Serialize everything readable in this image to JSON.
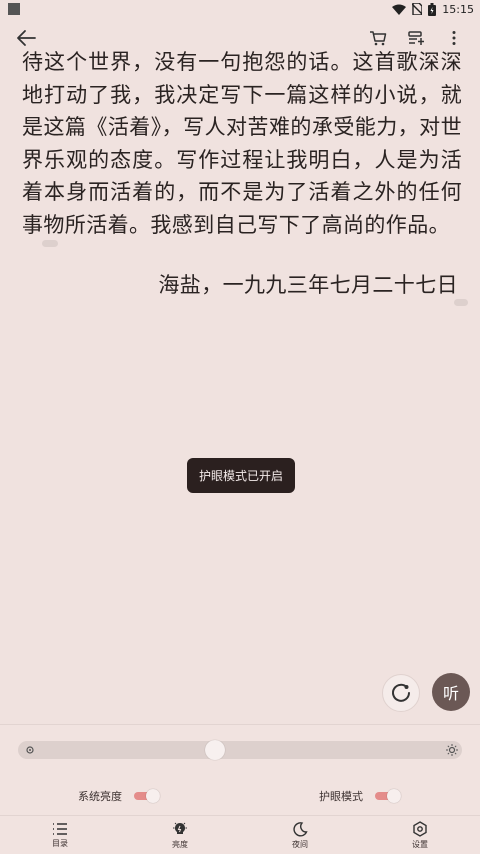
{
  "status_bar": {
    "time": "15:15"
  },
  "toolbar": {
    "back_icon": "arrow-left-icon",
    "cart_icon": "cart-icon",
    "bookshelf_icon": "bookshelf-add-icon",
    "more_icon": "more-vertical-icon"
  },
  "reading": {
    "paragraph": "待这个世界，没有一句抱怨的话。这首歌深深地打动了我，我决定写下一篇这样的小说，就是这篇《活着》，写人对苦难的承受能力，对世界乐观的态度。写作过程让我明白，人是为活着本身而活着的，而不是为了活着之外的任何事物所活着。我感到自己写下了高尚的作品。",
    "date_line": "海盐，一九九三年七月二十七日"
  },
  "toast": {
    "text": "护眼模式已开启"
  },
  "fab": {
    "listen_label": "听"
  },
  "panel": {
    "brightness_level": 0.44,
    "system_brightness_label": "系统亮度",
    "eye_protection_label": "护眼模式",
    "accent_color": "#e48c8a"
  },
  "bottom_nav": [
    {
      "label": "目录",
      "icon": "list-icon"
    },
    {
      "label": "亮度",
      "icon": "brightness-bulb-icon"
    },
    {
      "label": "夜间",
      "icon": "moon-icon"
    },
    {
      "label": "设置",
      "icon": "settings-hexagon-icon"
    }
  ]
}
